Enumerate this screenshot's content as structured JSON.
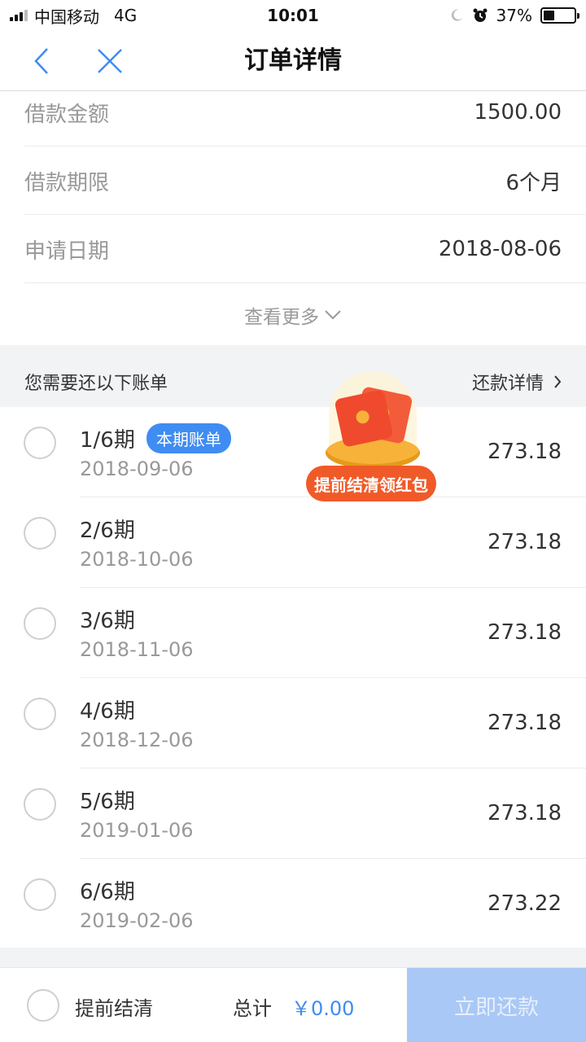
{
  "status_bar": {
    "carrier": "中国移动",
    "network": "4G",
    "time": "10:01",
    "battery_percent_text": "37%",
    "battery_level": 0.37
  },
  "nav": {
    "title": "订单详情",
    "back_icon": "chevron-left-icon",
    "close_icon": "close-icon"
  },
  "info": {
    "rows": [
      {
        "label": "借款金额",
        "value": "1500.00"
      },
      {
        "label": "借款期限",
        "value": "6个月"
      },
      {
        "label": "申请日期",
        "value": "2018-08-06"
      }
    ],
    "more_label": "查看更多"
  },
  "bills_header": {
    "title": "您需要还以下账单",
    "link_label": "还款详情"
  },
  "bills": [
    {
      "period": "1/6期",
      "date": "2018-09-06",
      "amount": "273.18",
      "badge": "本期账单"
    },
    {
      "period": "2/6期",
      "date": "2018-10-06",
      "amount": "273.18"
    },
    {
      "period": "3/6期",
      "date": "2018-11-06",
      "amount": "273.18"
    },
    {
      "period": "4/6期",
      "date": "2018-12-06",
      "amount": "273.18"
    },
    {
      "period": "5/6期",
      "date": "2019-01-06",
      "amount": "273.18"
    },
    {
      "period": "6/6期",
      "date": "2019-02-06",
      "amount": "273.22"
    }
  ],
  "promo": {
    "label": "提前结清领红包"
  },
  "bottom_bar": {
    "settle_label": "提前结清",
    "total_label": "总计",
    "total_value": "￥0.00",
    "pay_label": "立即还款"
  },
  "colors": {
    "accent": "#3f8cf2",
    "pay_button_disabled": "#a9c8f5",
    "promo": "#f05a29"
  }
}
